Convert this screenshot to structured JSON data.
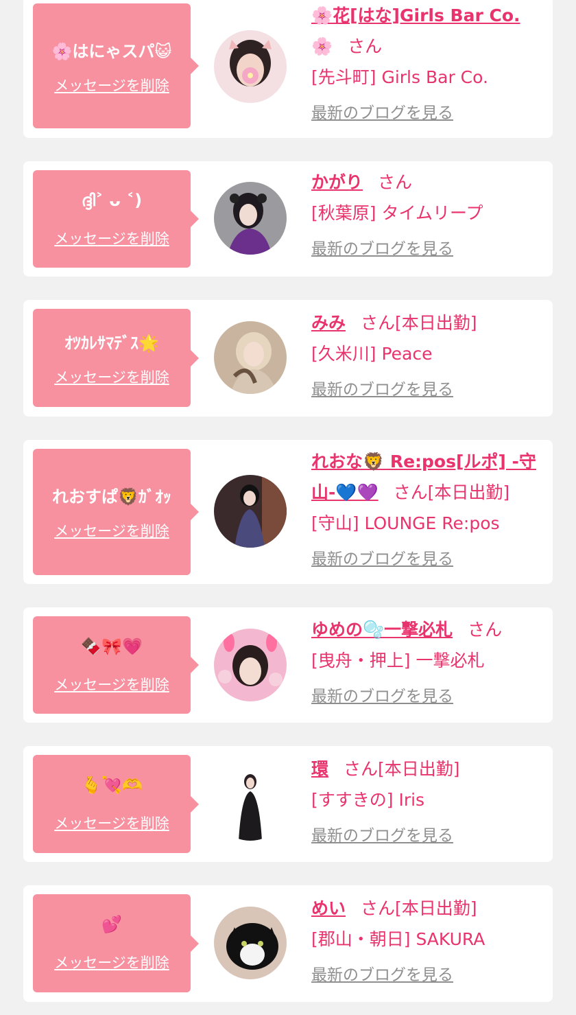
{
  "delete_label": "メッセージを削除",
  "blog_label": "最新のブログを見る",
  "colors": {
    "background": "#f1f1f1",
    "card": "#ffffff",
    "bubble": "#f7909f",
    "accent": "#e8336d",
    "link_gray": "#8f8f8f"
  },
  "entries": [
    {
      "message": "🌸はにゃスパ😺",
      "name": "🌸花[はな]Girls Bar Co.",
      "name_line2": "🌸",
      "suffix": "さん",
      "shop": "[先斗町] Girls Bar Co.",
      "avatar_icon": "avatar-photo-icon"
    },
    {
      "message": "ദ്ദി˃ ᴗ ˂)",
      "name": "かがり",
      "suffix": "さん",
      "shop": "[秋葉原] タイムリープ",
      "avatar_icon": "avatar-photo-icon"
    },
    {
      "message": "ｵﾂｶﾚｻﾏﾃﾞｽ🌟",
      "name": "みみ",
      "suffix": "さん[本日出勤]",
      "shop": "[久米川] Peace",
      "avatar_icon": "avatar-photo-icon"
    },
    {
      "message": "れおすぱ🦁ｶﾞｵｯ",
      "name": "れおな🦁 Re:pos[ルポ] -守",
      "name_line2": "山-💙💜",
      "suffix": "さん[本日出勤]",
      "shop": "[守山] LOUNGE Re:pos",
      "avatar_icon": "avatar-photo-icon"
    },
    {
      "message": "🍫🎀💗",
      "name": "ゆめの🫧一撃必札",
      "suffix": "さん",
      "shop": "[曳舟・押上] 一撃必札",
      "avatar_icon": "avatar-photo-icon"
    },
    {
      "message": "🫰💘🫶",
      "name": "環",
      "suffix": "さん[本日出勤]",
      "shop": "[すすきの] Iris",
      "avatar_icon": "avatar-photo-icon"
    },
    {
      "message": "💕",
      "name": "めい",
      "suffix": "さん[本日出勤]",
      "shop": "[郡山・朝日] SAKURA",
      "avatar_icon": "avatar-cat-photo-icon"
    }
  ]
}
